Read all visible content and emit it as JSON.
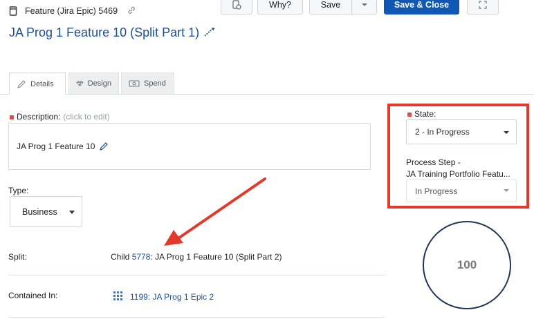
{
  "header": {
    "item_type": "Feature (Jira Epic) 5469",
    "title": "JA Prog 1 Feature 10 (Split Part 1)"
  },
  "toolbar": {
    "why_label": "Why?",
    "save_label": "Save",
    "save_close_label": "Save & Close"
  },
  "tabs": [
    {
      "label": "Details"
    },
    {
      "label": "Design"
    },
    {
      "label": "Spend"
    }
  ],
  "description": {
    "label": "Description:",
    "hint": "(click to edit)",
    "value": "JA Prog 1 Feature 10"
  },
  "type_field": {
    "label": "Type:",
    "value": "Business"
  },
  "split": {
    "label": "Split:",
    "prefix": "Child",
    "child_id": "5778",
    "child_title": ": JA Prog 1 Feature 10 (Split Part 2)"
  },
  "contained_in": {
    "label": "Contained In:",
    "value": "1199: JA Prog 1 Epic 2"
  },
  "state": {
    "label": "State:",
    "value": "2 - In Progress"
  },
  "process_step": {
    "label_line1": "Process Step -",
    "label_line2": "JA Training Portfolio Featu...",
    "value": "In Progress"
  },
  "progress_circle": {
    "value": "100"
  },
  "colors": {
    "primary": "#1158b4",
    "link": "#1d4f91",
    "required": "#e04a4a",
    "highlight": "#e23a2a"
  }
}
